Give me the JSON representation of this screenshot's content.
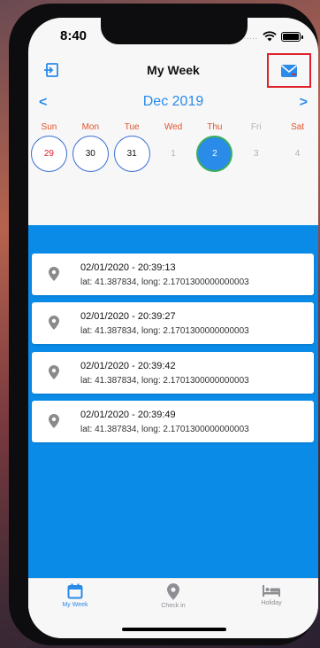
{
  "status_bar": {
    "time": "8:40",
    "signal_dots": "....."
  },
  "navbar": {
    "title": "My Week",
    "left_icon": "logout-icon",
    "right_icon": "mail-icon"
  },
  "calendar": {
    "month_label": "Dec 2019",
    "prev_label": "<",
    "next_label": ">",
    "weekdays": [
      "Sun",
      "Mon",
      "Tue",
      "Wed",
      "Thu",
      "Fri",
      "Sat"
    ],
    "days": [
      "29",
      "30",
      "31",
      "1",
      "2",
      "3",
      "4"
    ],
    "selected_day": "2"
  },
  "checkins": [
    {
      "title": "02/01/2020 - 20:39:13",
      "location": "lat: 41.387834, long: 2.1701300000000003"
    },
    {
      "title": "02/01/2020 - 20:39:27",
      "location": "lat: 41.387834, long: 2.1701300000000003"
    },
    {
      "title": "02/01/2020 - 20:39:42",
      "location": "lat: 41.387834, long: 2.1701300000000003"
    },
    {
      "title": "02/01/2020 - 20:39:49",
      "location": "lat: 41.387834, long: 2.1701300000000003"
    }
  ],
  "tabs": [
    {
      "label": "My Week",
      "icon": "calendar-icon",
      "active": true
    },
    {
      "label": "Check in",
      "icon": "location-pin-icon",
      "active": false
    },
    {
      "label": "Holiday",
      "icon": "bed-icon",
      "active": false
    }
  ],
  "colors": {
    "accent": "#2a8be8",
    "list_background": "#0a8be8",
    "weekend": "#e0552a",
    "highlight_box": "#e0202a",
    "inactive_tab": "#8e8e93"
  }
}
